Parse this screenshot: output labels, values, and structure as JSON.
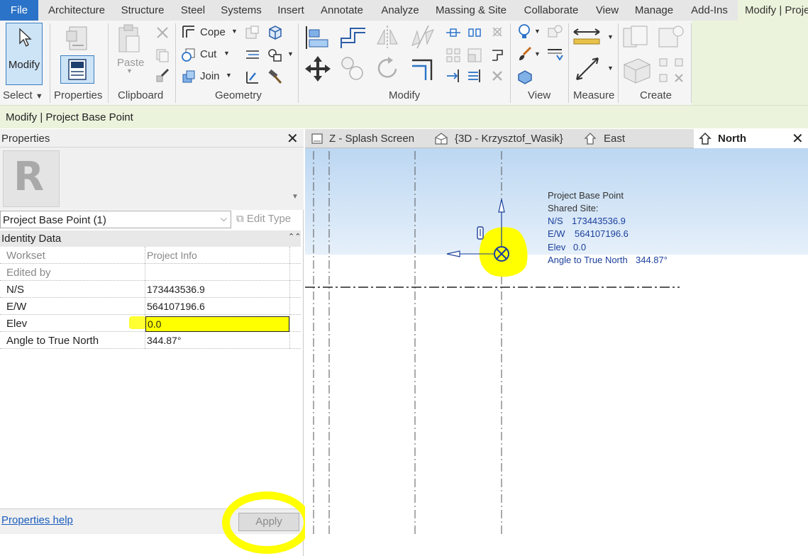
{
  "menu": {
    "tabs": [
      {
        "label": "File"
      },
      {
        "label": "Architecture"
      },
      {
        "label": "Structure"
      },
      {
        "label": "Steel"
      },
      {
        "label": "Systems"
      },
      {
        "label": "Insert"
      },
      {
        "label": "Annotate"
      },
      {
        "label": "Analyze"
      },
      {
        "label": "Massing & Site"
      },
      {
        "label": "Collaborate"
      },
      {
        "label": "View"
      },
      {
        "label": "Manage"
      },
      {
        "label": "Add-Ins"
      },
      {
        "label": "Modify | Proje"
      }
    ]
  },
  "ribbon": {
    "modify_label": "Modify",
    "paste_label": "Paste",
    "cope_label": "Cope",
    "cut_label": "Cut",
    "join_label": "Join",
    "panels": {
      "select": "Select",
      "properties": "Properties",
      "clipboard": "Clipboard",
      "geometry": "Geometry",
      "modify": "Modify",
      "view": "View",
      "measure": "Measure",
      "create": "Create"
    }
  },
  "context_bar": {
    "title": "Modify | Project Base Point"
  },
  "properties": {
    "title": "Properties",
    "instance_selector": "Project Base Point (1)",
    "edit_type_label": "Edit Type",
    "group": "Identity Data",
    "rows": [
      {
        "key": "Workset",
        "value": "Project Info"
      },
      {
        "key": "Edited by",
        "value": ""
      },
      {
        "key": "N/S",
        "value": "173443536.9"
      },
      {
        "key": "E/W",
        "value": "564107196.6"
      },
      {
        "key": "Elev",
        "value": "0.0"
      },
      {
        "key": "Angle to True North",
        "value": "344.87°"
      }
    ],
    "help_link": "Properties help",
    "apply_label": "Apply"
  },
  "view_tabs": [
    {
      "label": "Z - Splash Screen",
      "icon": "sheet-icon"
    },
    {
      "label": "{3D - Krzysztof_Wasik}",
      "icon": "3d-house-icon"
    },
    {
      "label": "East",
      "icon": "elevation-icon"
    },
    {
      "label": "North",
      "icon": "elevation-icon"
    }
  ],
  "canvas": {
    "info": {
      "title": "Project Base Point",
      "shared": "Shared Site:",
      "ns_label": "N/S",
      "ns_value": "173443536.9",
      "ew_label": "E/W",
      "ew_value": "564107196.6",
      "elev_label": "Elev",
      "elev_value": "0.0",
      "angle_label": "Angle to True North",
      "angle_value": "344.87°"
    }
  },
  "colors": {
    "file_tab": "#2b73c8",
    "context_green": "#ebf3dc",
    "highlight": "#ffff00",
    "link": "#1a5dbd",
    "canvas_blue_text": "#1b3f9c"
  }
}
